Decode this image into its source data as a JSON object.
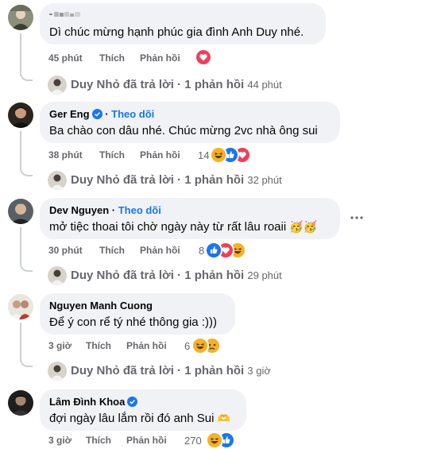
{
  "comments": [
    {
      "name": "",
      "text": "Dì chúc mừng hạnh phúc gia đình Anh Duy nhé.",
      "time": "45 phút",
      "like": "Thích",
      "reply": "Phản hồi",
      "reaction_count": "",
      "reactions": [
        "love"
      ],
      "replies": {
        "author": "Duy Nhỏ",
        "action": "đã trả lời",
        "sep": "·",
        "count": "1 phản hồi",
        "time": "44 phút"
      }
    },
    {
      "name": "Ger Eng",
      "verified": true,
      "follow": "Theo dõi",
      "text": "Ba chào con dâu nhé. Chúc mừng 2vc nhà ông sui",
      "time": "38 phút",
      "like": "Thích",
      "reply": "Phản hồi",
      "reaction_count": "14",
      "reactions": [
        "haha",
        "like",
        "love"
      ],
      "replies": {
        "author": "Duy Nhỏ",
        "action": "đã trả lời",
        "sep": "·",
        "count": "1 phản hồi",
        "time": "32 phút"
      }
    },
    {
      "name": "Dev Nguyen",
      "follow": "Theo dõi",
      "text": "mở tiệc thoai tôi chờ ngày này từ rất lâu roaii",
      "emoji": "🥳🥳",
      "time": "30 phút",
      "like": "Thích",
      "reply": "Phản hồi",
      "reaction_count": "8",
      "reactions": [
        "like",
        "love",
        "haha"
      ],
      "replies": {
        "author": "Duy Nhỏ",
        "action": "đã trả lời",
        "sep": "·",
        "count": "1 phản hồi",
        "time": "29 phút"
      }
    },
    {
      "name": "Nguyen Manh Cuong",
      "text": "Để ý con rể tý nhé thông gia :)))",
      "time": "3 giờ",
      "like": "Thích",
      "reply": "Phản hồi",
      "reaction_count": "6",
      "reactions": [
        "haha",
        "sad"
      ],
      "replies": {
        "author": "Duy Nhỏ",
        "action": "đã trả lời",
        "sep": "·",
        "count": "1 phản hồi",
        "time": "3 giờ"
      }
    },
    {
      "name": "Lâm Đình Khoa",
      "verified": true,
      "text": "đợi ngày lâu lắm rồi đó anh Sui",
      "emoji": "🫶",
      "time": "3 giờ",
      "like": "Thích",
      "reply": "Phản hồi",
      "reaction_count": "270",
      "reactions": [
        "haha",
        "like"
      ]
    }
  ],
  "more_options_icon": "more-horizontal-icon",
  "colors": {
    "bubble": "#f0f2f5",
    "meta": "#65676b",
    "link": "#1877f2",
    "like": "#1877f2",
    "love": "#f33e58",
    "haha": "#f7b125"
  }
}
